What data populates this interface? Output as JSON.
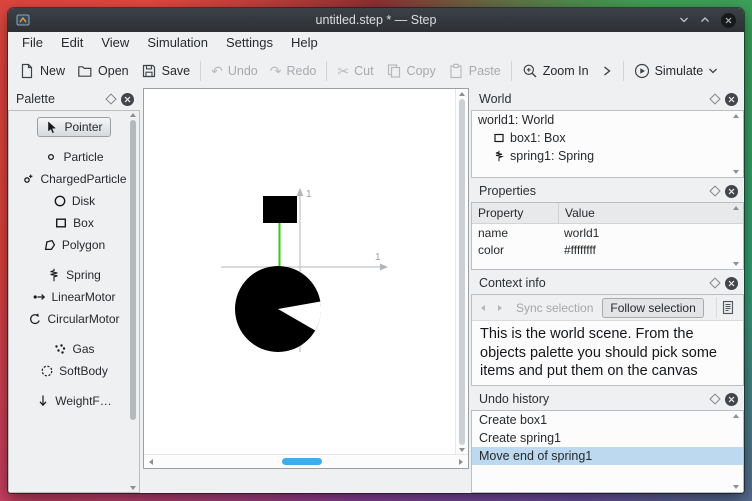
{
  "window": {
    "title": "untitled.step * — Step"
  },
  "menubar": {
    "items": [
      "File",
      "Edit",
      "View",
      "Simulation",
      "Settings",
      "Help"
    ]
  },
  "toolbar": {
    "new": "New",
    "open": "Open",
    "save": "Save",
    "undo": "Undo",
    "redo": "Redo",
    "cut": "Cut",
    "copy": "Copy",
    "paste": "Paste",
    "zoom_in": "Zoom In",
    "simulate": "Simulate"
  },
  "palette": {
    "title": "Palette",
    "items": [
      {
        "label": "Pointer",
        "icon": "pointer-icon",
        "selected": true
      },
      {
        "label": "Particle",
        "icon": "particle-icon"
      },
      {
        "label": "ChargedParticle",
        "icon": "charged-particle-icon"
      },
      {
        "label": "Disk",
        "icon": "disk-icon"
      },
      {
        "label": "Box",
        "icon": "box-icon"
      },
      {
        "label": "Polygon",
        "icon": "polygon-icon"
      },
      {
        "label": "Spring",
        "icon": "spring-icon"
      },
      {
        "label": "LinearMotor",
        "icon": "linear-motor-icon"
      },
      {
        "label": "CircularMotor",
        "icon": "circular-motor-icon"
      },
      {
        "label": "Gas",
        "icon": "gas-icon"
      },
      {
        "label": "SoftBody",
        "icon": "softbody-icon"
      },
      {
        "label": "WeightF…",
        "icon": "weight-force-icon"
      }
    ]
  },
  "canvas": {
    "x_unit_label": "1",
    "y_unit_label": "1"
  },
  "world_panel": {
    "title": "World",
    "items": [
      {
        "label": "world1: World"
      },
      {
        "label": "box1: Box",
        "icon": "box-icon"
      },
      {
        "label": "spring1: Spring",
        "icon": "spring-icon"
      }
    ]
  },
  "properties_panel": {
    "title": "Properties",
    "columns": [
      "Property",
      "Value"
    ],
    "rows": [
      {
        "property": "name",
        "value": "world1"
      },
      {
        "property": "color",
        "value": "#ffffffff"
      }
    ]
  },
  "context_info": {
    "title": "Context info",
    "sync_selection": "Sync selection",
    "follow_selection": "Follow selection",
    "text": "This is the world scene. From the objects palette you should pick some items and put them on the canvas"
  },
  "undo_history": {
    "title": "Undo history",
    "items": [
      {
        "label": "Create box1"
      },
      {
        "label": "Create spring1"
      },
      {
        "label": "Move end of spring1",
        "selected": true
      }
    ]
  },
  "colors": {
    "accent": "#3daee9",
    "titlebar": "#31363b",
    "selection": "#bcd9ef",
    "spring_green": "#2ecc12"
  }
}
